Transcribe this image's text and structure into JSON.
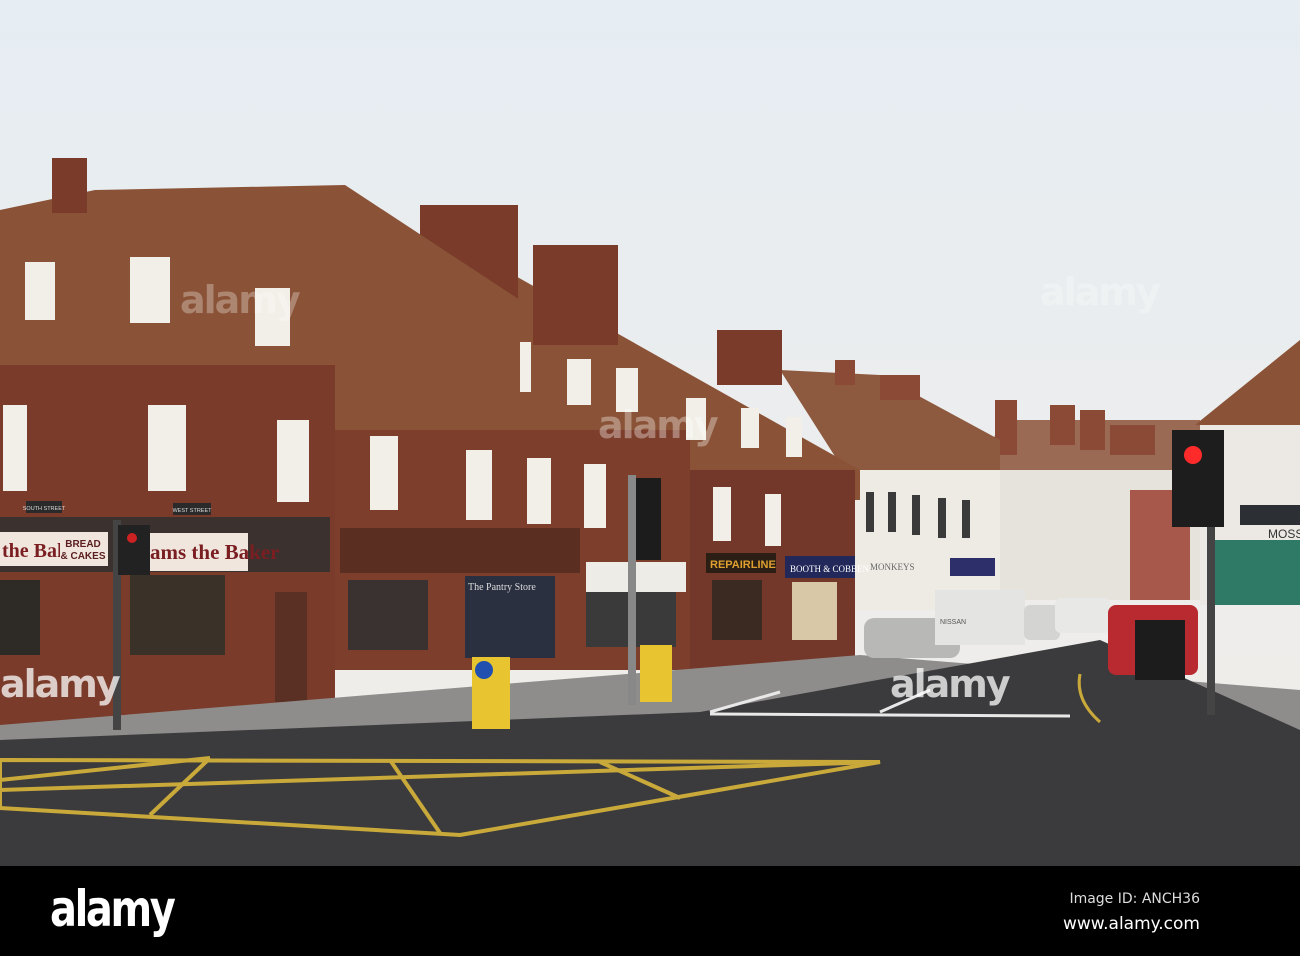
{
  "photo": {
    "signs": {
      "baker_left": "the Baker",
      "bread_cakes_line1": "BREAD",
      "bread_cakes_line2": "& CAKES",
      "baker_main": "ams the Baker",
      "south_street": "SOUTH STREET",
      "west_street": "WEST STREET",
      "pantry_store": "The Pantry Store",
      "repairline": "REPAIRLINE",
      "booth_cobben": "BOOTH & COBBEN",
      "monkeys": "MONKEYS",
      "moss": "MOSS",
      "van": "NISSAN"
    },
    "colors": {
      "sky": "#e9eef2",
      "brick": "#7a3b2a",
      "roof": "#8a5236",
      "road": "#3b3b3d",
      "yellow_line": "#c9a93a"
    }
  },
  "watermark": {
    "text": "alamy",
    "letter": "a"
  },
  "footer": {
    "logo": "alamy",
    "image_id": "Image ID: ANCH36",
    "url": "www.alamy.com"
  }
}
